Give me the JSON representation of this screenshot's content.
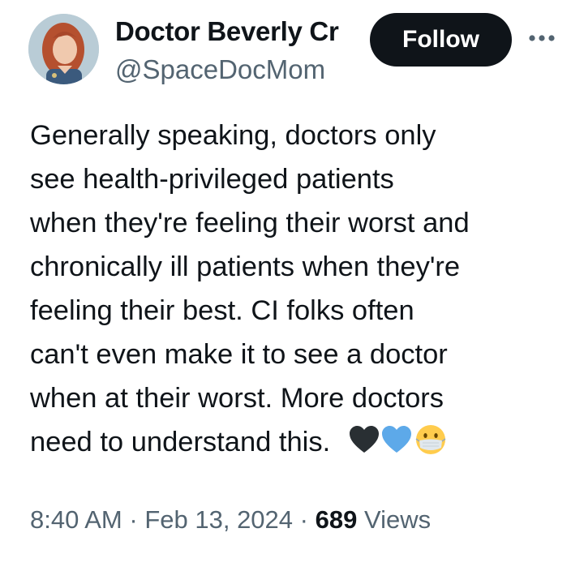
{
  "author": {
    "display_name": "Doctor Beverly Cr",
    "handle": "@SpaceDocMom",
    "avatar_icon": "profile-photo"
  },
  "actions": {
    "follow_label": "Follow",
    "more_icon": "more-options-icon"
  },
  "tweet": {
    "lines": [
      "Generally speaking, doctors only",
      "see health-privileged patients",
      "when they're feeling their worst and",
      "chronically ill patients when they're",
      "feeling their best. CI folks often",
      "can't even make it to see a doctor",
      "when at their worst. More doctors",
      "need to understand this."
    ],
    "emojis": [
      "black-heart-emoji",
      "blue-heart-emoji",
      "face-with-medical-mask-emoji"
    ]
  },
  "meta": {
    "time": "8:40 AM",
    "separator": "·",
    "date": "Feb 13, 2024",
    "views_count": "689",
    "views_label": "Views"
  },
  "colors": {
    "text": "#0f1419",
    "secondary": "#536471",
    "button_bg": "#0f1419",
    "button_text": "#ffffff",
    "blue_heart": "#5da9e9"
  }
}
